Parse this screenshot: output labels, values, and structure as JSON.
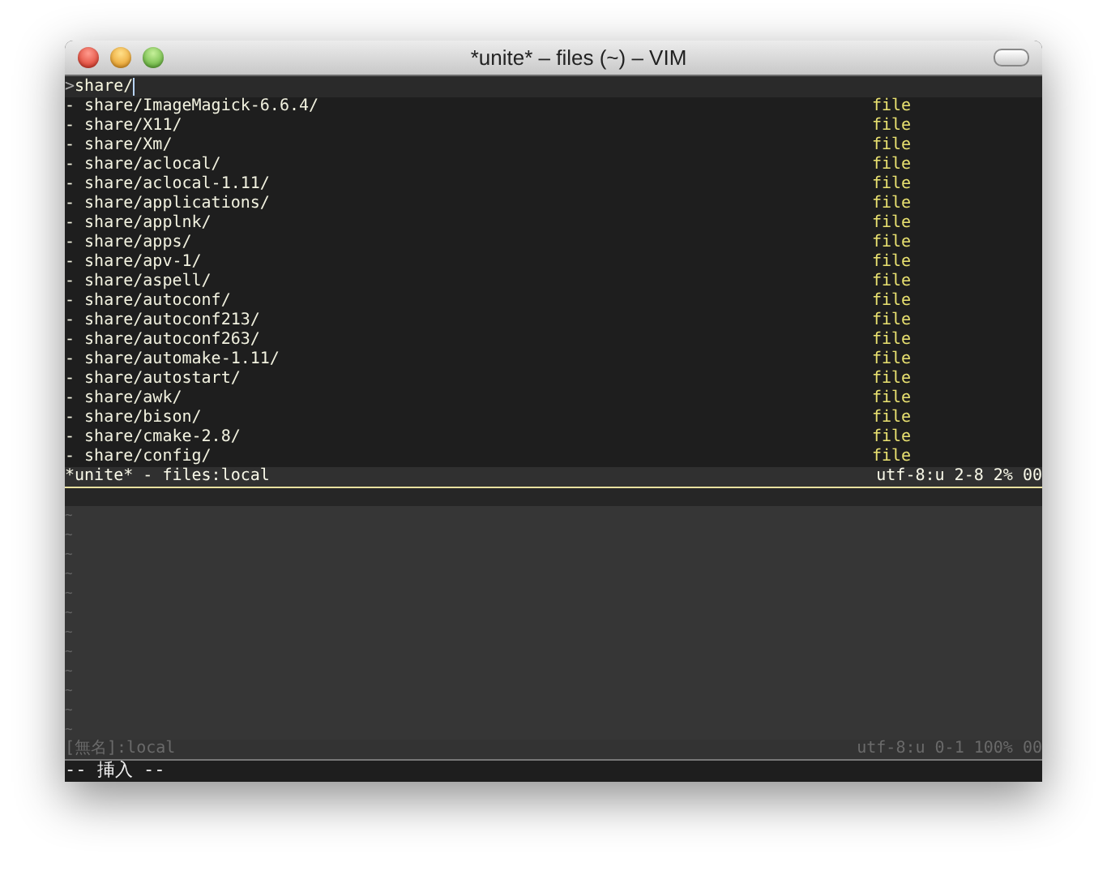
{
  "window": {
    "title": "*unite* – files (~) – VIM"
  },
  "prompt": {
    "marker": ">",
    "input": "share/"
  },
  "candidates": [
    {
      "name": "- share/ImageMagick-6.6.4/",
      "kind": "file"
    },
    {
      "name": "- share/X11/",
      "kind": "file"
    },
    {
      "name": "- share/Xm/",
      "kind": "file"
    },
    {
      "name": "- share/aclocal/",
      "kind": "file"
    },
    {
      "name": "- share/aclocal-1.11/",
      "kind": "file"
    },
    {
      "name": "- share/applications/",
      "kind": "file"
    },
    {
      "name": "- share/applnk/",
      "kind": "file"
    },
    {
      "name": "- share/apps/",
      "kind": "file"
    },
    {
      "name": "- share/apv-1/",
      "kind": "file"
    },
    {
      "name": "- share/aspell/",
      "kind": "file"
    },
    {
      "name": "- share/autoconf/",
      "kind": "file"
    },
    {
      "name": "- share/autoconf213/",
      "kind": "file"
    },
    {
      "name": "- share/autoconf263/",
      "kind": "file"
    },
    {
      "name": "- share/automake-1.11/",
      "kind": "file"
    },
    {
      "name": "- share/autostart/",
      "kind": "file"
    },
    {
      "name": "- share/awk/",
      "kind": "file"
    },
    {
      "name": "- share/bison/",
      "kind": "file"
    },
    {
      "name": "- share/cmake-2.8/",
      "kind": "file"
    },
    {
      "name": "- share/config/",
      "kind": "file"
    }
  ],
  "status_lines": [
    {
      "left": "*unite* - files:local",
      "right": "utf-8:u 2-8 2% 00",
      "current": true
    },
    {
      "left": "[無名]:local",
      "right": "utf-8:u 0-1 100% 00",
      "current": false
    }
  ],
  "empty_buffer": {
    "lines": [
      "~",
      "~",
      "~",
      "~",
      "~",
      "~",
      "~",
      "~",
      "~",
      "~",
      "~",
      "~"
    ]
  },
  "command_line": "-- 挿入 --"
}
